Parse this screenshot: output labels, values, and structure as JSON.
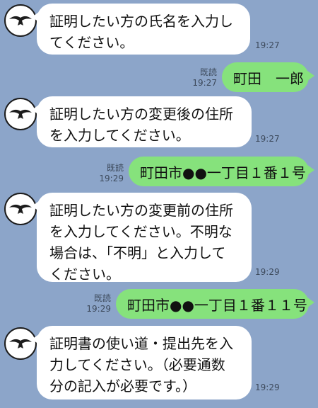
{
  "messages": [
    {
      "text": "証明したい方の氏名を入力してください。",
      "time": "19:27"
    },
    {
      "text": "町田　一郎",
      "time": "19:27",
      "read": "既読"
    },
    {
      "text": "証明したい方の変更後の住所を入力してください。",
      "time": "19:27"
    },
    {
      "text": "町田市●●一丁目１番１号",
      "time": "19:29",
      "read": "既読"
    },
    {
      "text": "証明したい方の変更前の住所を入力してください。不明な場合は、「不明」と入力してください。",
      "time": "19:29"
    },
    {
      "text": "町田市●●一丁目１番１１号",
      "time": "19:29",
      "read": "既読"
    },
    {
      "text": "証明書の使い道・提出先を入力してください。（必要通数分の記入が必要です。）",
      "time": "19:29"
    }
  ],
  "colors": {
    "background": "#8ca5c9",
    "incoming_bubble": "#ffffff",
    "outgoing_bubble": "#86e27c"
  },
  "icons": {
    "avatar": "bird-logo-icon"
  }
}
